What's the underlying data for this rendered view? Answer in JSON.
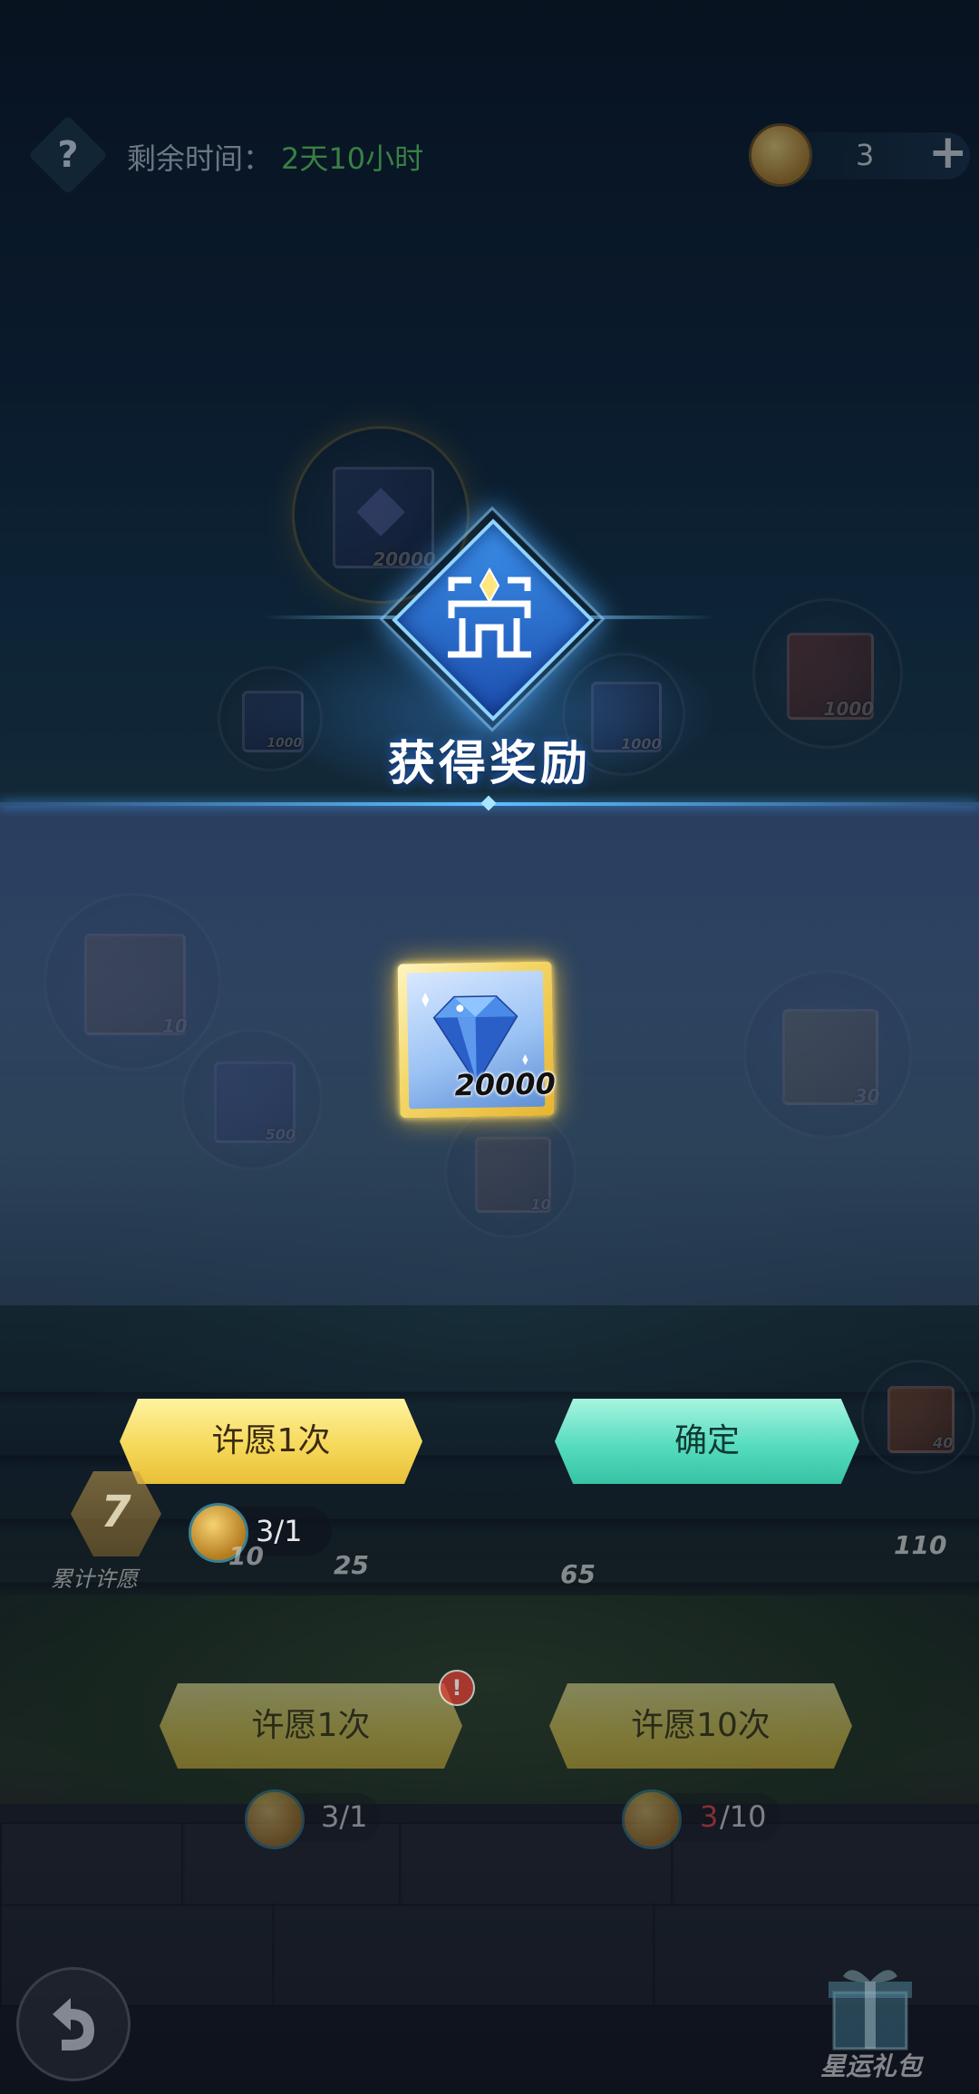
{
  "topbar": {
    "help_icon": "question-icon",
    "time_label": "剩余时间：",
    "time_value": "2天10小时",
    "coin_count": "3",
    "add_label": "+"
  },
  "background_rewards": [
    {
      "qty": "20000",
      "icon": "gem-icon"
    },
    {
      "qty": "1000",
      "icon": "gem-icon"
    },
    {
      "qty": "1000",
      "icon": "gem-icon"
    },
    {
      "qty": "1000",
      "icon": "gem-icon"
    },
    {
      "qty": "10",
      "icon": "chest-icon"
    },
    {
      "qty": "500",
      "icon": "potion-icon"
    },
    {
      "qty": "30",
      "icon": "hex-token-icon"
    },
    {
      "qty": "10",
      "icon": "chest-icon"
    },
    {
      "qty": "40",
      "icon": "compass-icon"
    }
  ],
  "popup": {
    "title": "获得奖励",
    "reward": {
      "qty": "20000",
      "icon": "blue-diamond-icon"
    },
    "wish_once_button": "许愿1次",
    "confirm_button": "确定",
    "cost": "3/1"
  },
  "progress": {
    "wish_total": "7",
    "wish_total_label": "累计许愿",
    "milestones": [
      "10",
      "25",
      "65",
      "110"
    ]
  },
  "bottom": {
    "wish_once_button": "许愿1次",
    "wish_ten_button": "许愿10次",
    "cost_once": "3/1",
    "cost_ten_have": "3",
    "cost_ten_need": "/10",
    "alert": "!",
    "gift_label": "星运礼包",
    "back_icon": "back-arrow-icon"
  },
  "colors": {
    "accent_blue": "#5bc0ff",
    "yellow_button": "#f6d95a",
    "teal_button": "#56dcbf",
    "time_green": "#5ac85a"
  }
}
